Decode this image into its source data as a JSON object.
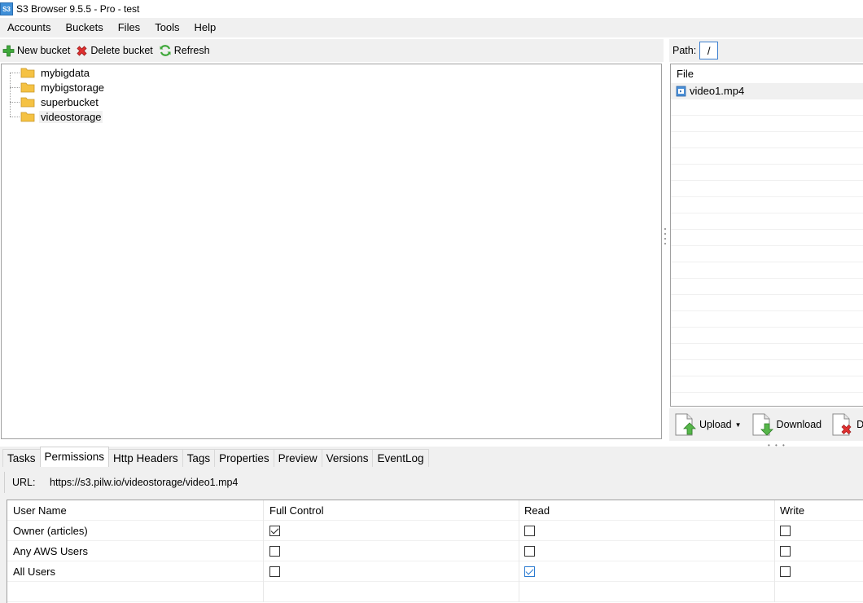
{
  "window": {
    "title": "S3 Browser 9.5.5 - Pro - test",
    "app_icon_text": "S3"
  },
  "menu": [
    "Accounts",
    "Buckets",
    "Files",
    "Tools",
    "Help"
  ],
  "bucket_toolbar": {
    "new_bucket": "New bucket",
    "delete_bucket": "Delete bucket",
    "refresh": "Refresh"
  },
  "buckets": [
    "mybigdata",
    "mybigstorage",
    "superbucket",
    "videostorage"
  ],
  "selected_bucket": "videostorage",
  "path": {
    "label": "Path:",
    "value": "/"
  },
  "files": {
    "header": "File",
    "items": [
      "video1.mp4"
    ]
  },
  "file_actions": {
    "upload": "Upload",
    "download": "Download",
    "delete": "De"
  },
  "tabs": [
    "Tasks",
    "Permissions",
    "Http Headers",
    "Tags",
    "Properties",
    "Preview",
    "Versions",
    "EventLog"
  ],
  "active_tab": "Permissions",
  "permissions": {
    "url_label": "URL:",
    "url": "https://s3.pilw.io/videostorage/video1.mp4",
    "columns": [
      "User Name",
      "Full Control",
      "Read",
      "Write"
    ],
    "rows": [
      {
        "user": "Owner (articles)",
        "full_control": true,
        "read": false,
        "write": false
      },
      {
        "user": "Any AWS Users",
        "full_control": false,
        "read": false,
        "write": false
      },
      {
        "user": "All Users",
        "full_control": false,
        "read": true,
        "write": false
      }
    ]
  },
  "colors": {
    "accent": "#3c7fd0",
    "panel_bg": "#f0f0f0",
    "border": "#a0a0a0"
  }
}
